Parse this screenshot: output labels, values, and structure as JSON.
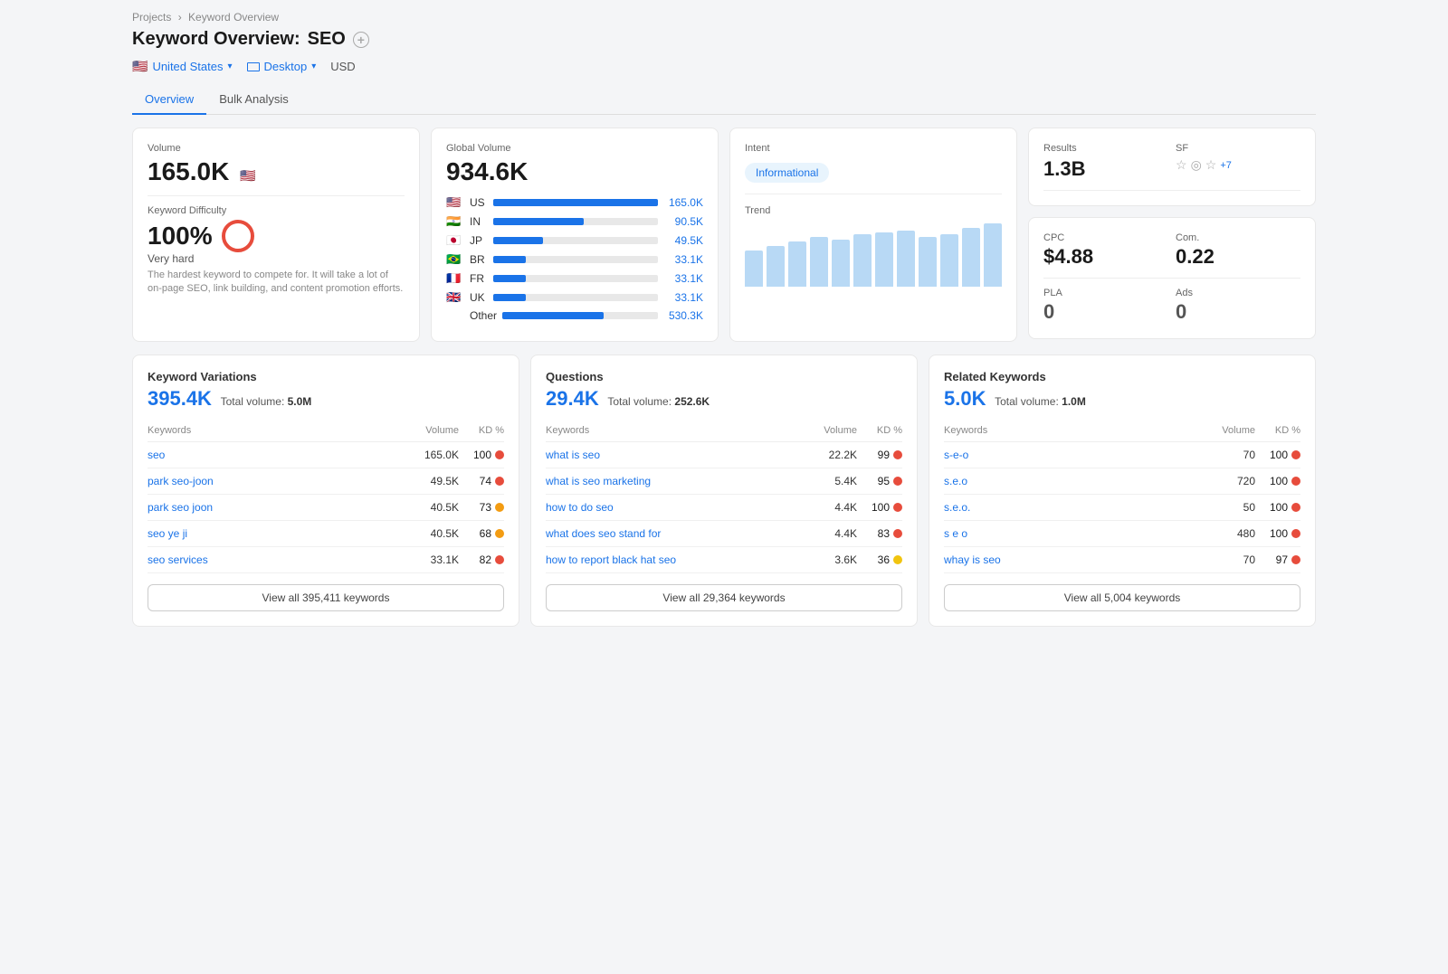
{
  "breadcrumb": {
    "parent": "Projects",
    "current": "Keyword Overview"
  },
  "pageTitle": {
    "prefix": "Keyword Overview:",
    "keyword": "SEO"
  },
  "toolbar": {
    "country": "United States",
    "device": "Desktop",
    "currency": "USD"
  },
  "tabs": [
    {
      "label": "Overview",
      "active": true
    },
    {
      "label": "Bulk Analysis",
      "active": false
    }
  ],
  "volumeCard": {
    "label": "Volume",
    "value": "165.0K",
    "kdLabel": "Keyword Difficulty",
    "kdValue": "100%",
    "kdHard": "Very hard",
    "kdDesc": "The hardest keyword to compete for. It will take a lot of on-page SEO, link building, and content promotion efforts."
  },
  "globalVolumeCard": {
    "label": "Global Volume",
    "value": "934.6K",
    "countries": [
      {
        "flag": "🇺🇸",
        "code": "US",
        "bar": 100,
        "val": "165.0K"
      },
      {
        "flag": "🇮🇳",
        "code": "IN",
        "bar": 55,
        "val": "90.5K"
      },
      {
        "flag": "🇯🇵",
        "code": "JP",
        "bar": 30,
        "val": "49.5K"
      },
      {
        "flag": "🇧🇷",
        "code": "BR",
        "bar": 20,
        "val": "33.1K"
      },
      {
        "flag": "🇫🇷",
        "code": "FR",
        "bar": 20,
        "val": "33.1K"
      },
      {
        "flag": "🇬🇧",
        "code": "UK",
        "bar": 20,
        "val": "33.1K"
      }
    ],
    "otherLabel": "Other",
    "otherBar": 65,
    "otherVal": "530.3K"
  },
  "intentCard": {
    "label": "Intent",
    "badge": "Informational",
    "trendLabel": "Trend",
    "trendBars": [
      40,
      45,
      50,
      55,
      52,
      58,
      60,
      62,
      55,
      58,
      65,
      70
    ]
  },
  "resultsCard": {
    "resultsLabel": "Results",
    "resultsVal": "1.3B",
    "sfLabel": "SF",
    "sfIcons": [
      "☆",
      "◎",
      "☆"
    ],
    "sfMore": "+7"
  },
  "metricsCard": {
    "cpcLabel": "CPC",
    "cpcVal": "$4.88",
    "comLabel": "Com.",
    "comVal": "0.22",
    "plaLabel": "PLA",
    "plaVal": "0",
    "adsLabel": "Ads",
    "adsVal": "0"
  },
  "keywordVariations": {
    "title": "Keyword Variations",
    "count": "395.4K",
    "totalLabel": "Total volume:",
    "totalVal": "5.0M",
    "headers": [
      "Keywords",
      "Volume",
      "KD %"
    ],
    "rows": [
      {
        "kw": "seo",
        "vol": "165.0K",
        "kd": "100",
        "dotClass": "dot-red"
      },
      {
        "kw": "park seo-joon",
        "vol": "49.5K",
        "kd": "74",
        "dotClass": "dot-red"
      },
      {
        "kw": "park seo joon",
        "vol": "40.5K",
        "kd": "73",
        "dotClass": "dot-orange"
      },
      {
        "kw": "seo ye ji",
        "vol": "40.5K",
        "kd": "68",
        "dotClass": "dot-orange"
      },
      {
        "kw": "seo services",
        "vol": "33.1K",
        "kd": "82",
        "dotClass": "dot-red"
      }
    ],
    "viewAllBtn": "View all 395,411 keywords"
  },
  "questions": {
    "title": "Questions",
    "count": "29.4K",
    "totalLabel": "Total volume:",
    "totalVal": "252.6K",
    "headers": [
      "Keywords",
      "Volume",
      "KD %"
    ],
    "rows": [
      {
        "kw": "what is seo",
        "vol": "22.2K",
        "kd": "99",
        "dotClass": "dot-red"
      },
      {
        "kw": "what is seo marketing",
        "vol": "5.4K",
        "kd": "95",
        "dotClass": "dot-red"
      },
      {
        "kw": "how to do seo",
        "vol": "4.4K",
        "kd": "100",
        "dotClass": "dot-red"
      },
      {
        "kw": "what does seo stand for",
        "vol": "4.4K",
        "kd": "83",
        "dotClass": "dot-red"
      },
      {
        "kw": "how to report black hat seo",
        "vol": "3.6K",
        "kd": "36",
        "dotClass": "dot-yellow"
      }
    ],
    "viewAllBtn": "View all 29,364 keywords"
  },
  "relatedKeywords": {
    "title": "Related Keywords",
    "count": "5.0K",
    "totalLabel": "Total volume:",
    "totalVal": "1.0M",
    "headers": [
      "Keywords",
      "Volume",
      "KD %"
    ],
    "rows": [
      {
        "kw": "s-e-o",
        "vol": "70",
        "kd": "100",
        "dotClass": "dot-red"
      },
      {
        "kw": "s.e.o",
        "vol": "720",
        "kd": "100",
        "dotClass": "dot-red"
      },
      {
        "kw": "s.e.o.",
        "vol": "50",
        "kd": "100",
        "dotClass": "dot-red"
      },
      {
        "kw": "s e o",
        "vol": "480",
        "kd": "100",
        "dotClass": "dot-red"
      },
      {
        "kw": "whay is seo",
        "vol": "70",
        "kd": "97",
        "dotClass": "dot-red"
      }
    ],
    "viewAllBtn": "View all 5,004 keywords"
  }
}
